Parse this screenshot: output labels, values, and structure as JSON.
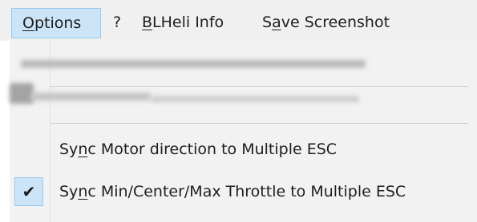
{
  "menubar": {
    "items": [
      {
        "label_accel": "O",
        "label_rest": "ptions"
      },
      {
        "label": "?"
      },
      {
        "label_accel": "B",
        "label_rest": "LHeli Info"
      },
      {
        "label_pre": "S",
        "label_accel": "a",
        "label_rest": "ve Screenshot"
      }
    ]
  },
  "dropdown": {
    "items": [
      {
        "label_pre": "Sy",
        "label_accel": "n",
        "label_rest": "c Motor direction to Multiple ESC",
        "checked": false
      },
      {
        "label_pre": "Sy",
        "label_accel": "n",
        "label_rest": "c Min/Center/Max Throttle to Multiple ESC",
        "checked": true
      }
    ],
    "check_glyph": "✔"
  },
  "colors": {
    "menubar_bg": "#f0f0f0",
    "menu_bg": "#f2f2f2",
    "highlight_bg": "#cce4f7",
    "highlight_border": "#99c9ef",
    "text": "#1e1e1e"
  }
}
